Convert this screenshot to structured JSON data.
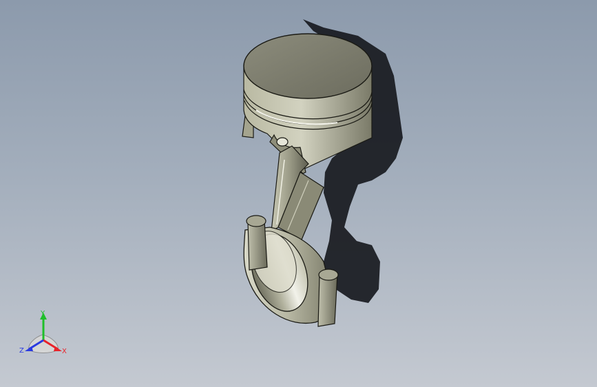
{
  "viewport": {
    "background_top": "#8c9aac",
    "background_bottom": "#c4c9d1",
    "model": "piston-connecting-rod-assembly"
  },
  "triad": {
    "x_label": "X",
    "y_label": "Y",
    "z_label": "Z",
    "colors": {
      "x": "#e8232a",
      "y": "#1fbf2a",
      "z": "#2a3ae0"
    }
  }
}
